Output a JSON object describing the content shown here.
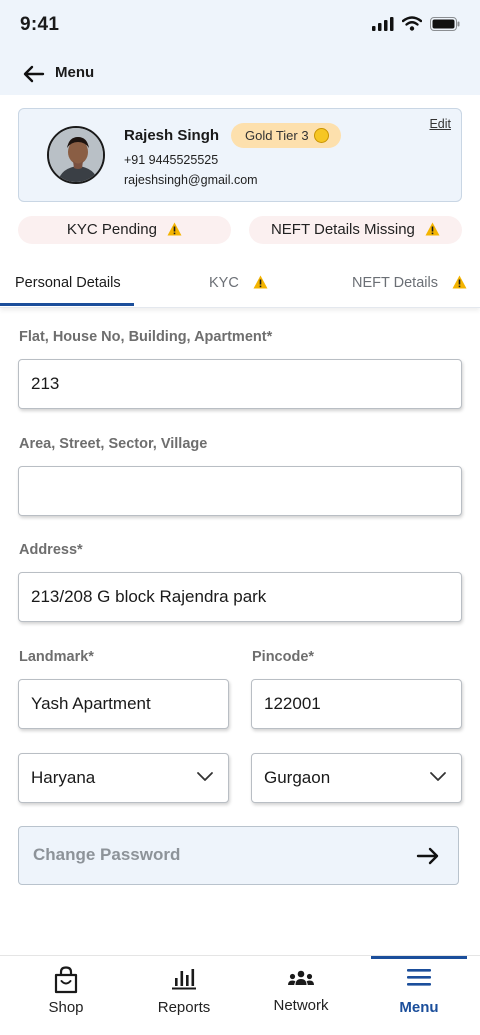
{
  "status_bar": {
    "time": "9:41"
  },
  "header": {
    "title": "Menu"
  },
  "profile": {
    "name": "Rajesh Singh",
    "tier": "Gold Tier 3",
    "phone": "+91 9445525525",
    "email": "rajeshsingh@gmail.com",
    "edit_label": "Edit"
  },
  "alerts": [
    {
      "label": "KYC Pending"
    },
    {
      "label": "NEFT Details Missing"
    }
  ],
  "tabs": [
    {
      "label": "Personal Details",
      "active": true
    },
    {
      "label": "KYC",
      "warning": true
    },
    {
      "label": "NEFT Details",
      "warning": true
    }
  ],
  "form": {
    "flat": {
      "label": "Flat, House No, Building, Apartment*",
      "value": "213"
    },
    "area": {
      "label": "Area, Street, Sector, Village",
      "value": ""
    },
    "address": {
      "label": "Address*",
      "value": "213/208 G block Rajendra park"
    },
    "landmark": {
      "label": "Landmark*",
      "value": "Yash Apartment"
    },
    "pincode": {
      "label": "Pincode*",
      "value": "122001"
    },
    "state": {
      "value": "Haryana"
    },
    "city": {
      "value": "Gurgaon"
    }
  },
  "change_password": {
    "label": "Change Password"
  },
  "bottom_nav": [
    {
      "label": "Shop",
      "icon": "shopping-bag-icon"
    },
    {
      "label": "Reports",
      "icon": "bar-chart-icon"
    },
    {
      "label": "Network",
      "icon": "people-icon"
    },
    {
      "label": "Menu",
      "icon": "hamburger-menu-icon",
      "active": true
    }
  ],
  "colors": {
    "accent": "#1b4e9b",
    "header_bg": "#eef4fb",
    "warning": "#f4b400",
    "tier_badge": "#fde0ad",
    "alert_chip": "#fbf0f0"
  }
}
